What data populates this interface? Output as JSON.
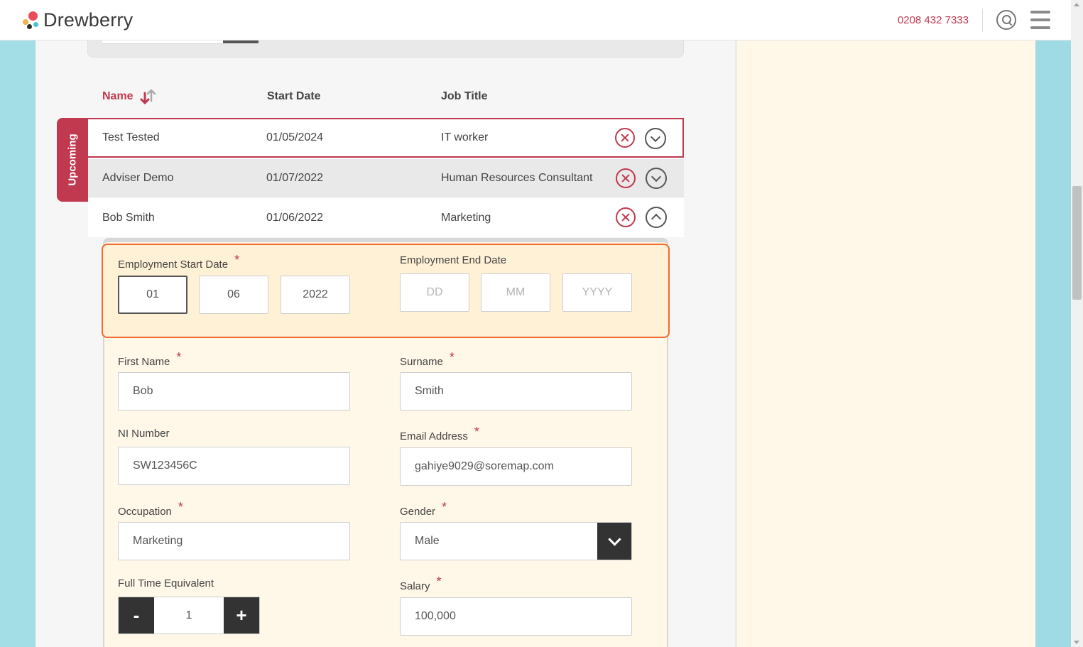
{
  "header": {
    "brand": "Drewberry",
    "phone": "0208 432 7333"
  },
  "table": {
    "columns": {
      "name": "Name",
      "start_date": "Start Date",
      "job_title": "Job Title"
    },
    "group_label": "Upcoming",
    "rows": [
      {
        "name": "Test Tested",
        "start_date": "01/05/2024",
        "job_title": "IT worker"
      },
      {
        "name": "Adviser Demo",
        "start_date": "01/07/2022",
        "job_title": "Human Resources Consultant"
      },
      {
        "name": "Bob Smith",
        "start_date": "01/06/2022",
        "job_title": "Marketing"
      }
    ]
  },
  "form": {
    "employment_start": {
      "label": "Employment Start Date",
      "required": "*",
      "day": "01",
      "month": "06",
      "year": "2022"
    },
    "employment_end": {
      "label": "Employment End Date",
      "day_placeholder": "DD",
      "month_placeholder": "MM",
      "year_placeholder": "YYYY"
    },
    "first_name": {
      "label": "First Name",
      "required": "*",
      "value": "Bob"
    },
    "surname": {
      "label": "Surname",
      "required": "*",
      "value": "Smith"
    },
    "ni_number": {
      "label": "NI Number",
      "value": "SW123456C"
    },
    "email": {
      "label": "Email Address",
      "required": "*",
      "value": "gahiye9029@soremap.com"
    },
    "occupation": {
      "label": "Occupation",
      "required": "*",
      "value": "Marketing"
    },
    "gender": {
      "label": "Gender",
      "required": "*",
      "value": "Male"
    },
    "fte": {
      "label": "Full Time Equivalent",
      "value": "1",
      "minus": "-",
      "plus": "+"
    },
    "salary": {
      "label": "Salary",
      "required": "*",
      "value": "100,000"
    }
  },
  "colors": {
    "brand_red": "#c0394f",
    "highlight_orange": "#ef6b2f",
    "cream": "#fff7e8"
  }
}
